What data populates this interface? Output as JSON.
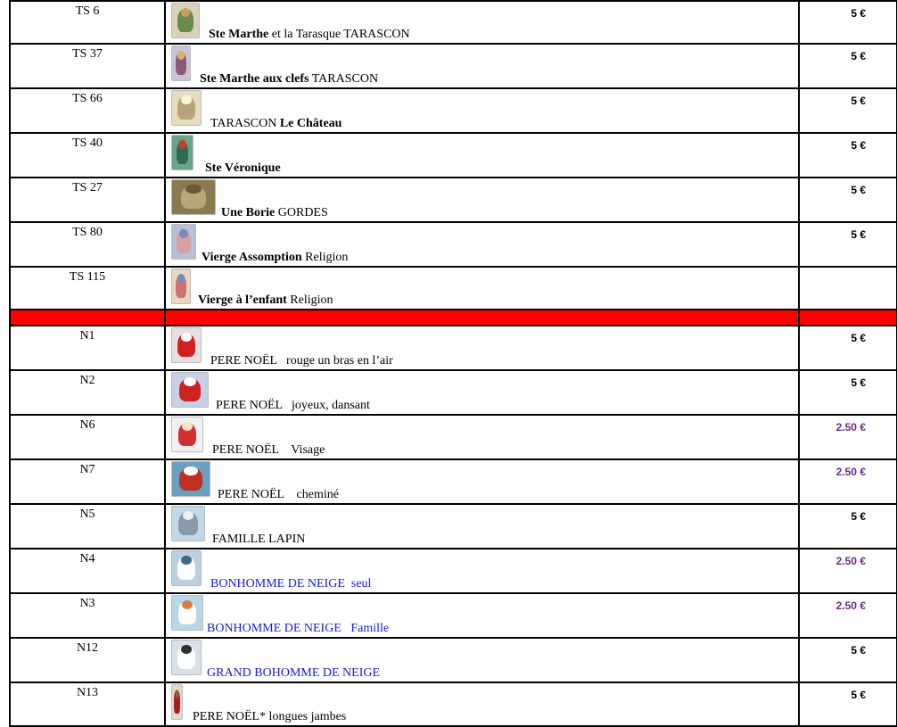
{
  "rows": [
    {
      "code": "TS 6",
      "icon": "saint-marthe-figure-icon",
      "parts": [
        {
          "t": "Ste Marthe",
          "b": true
        },
        {
          "t": " et la Tarasque TARASCON"
        }
      ],
      "price": "5 €"
    },
    {
      "code": "TS 37",
      "icon": "saint-marthe-keys-icon",
      "parts": [
        {
          "t": "Ste Marthe aux clefs",
          "b": true
        },
        {
          "t": " TARASCON"
        }
      ],
      "price": "5 €"
    },
    {
      "code": "TS 66",
      "icon": "castle-icon",
      "parts": [
        {
          "t": "TARASCON "
        },
        {
          "t": "Le Château",
          "b": true
        }
      ],
      "price": "5 €"
    },
    {
      "code": "TS 40",
      "icon": "saint-veronique-icon",
      "parts": [
        {
          "t": "Ste Véronique",
          "b": true
        }
      ],
      "price": "5 €"
    },
    {
      "code": "TS 27",
      "icon": "borie-hut-icon",
      "parts": [
        {
          "t": "Une Borie",
          "b": true
        },
        {
          "t": " GORDES"
        }
      ],
      "price": "5 €"
    },
    {
      "code": "TS 80",
      "icon": "virgin-assumption-icon",
      "parts": [
        {
          "t": "Vierge Assomption",
          "b": true
        },
        {
          "t": " Religion"
        }
      ],
      "price": "5 €"
    },
    {
      "code": "TS 115",
      "icon": "virgin-child-icon",
      "parts": [
        {
          "t": "Vierge à l’enfant",
          "b": true
        },
        {
          "t": " Religion"
        }
      ],
      "price": ""
    },
    {
      "sep": true
    },
    {
      "code": "N1",
      "icon": "santa-arm-up-icon",
      "parts": [
        {
          "t": "PERE NOËL   rouge un bras en l’air"
        }
      ],
      "price": "5 €"
    },
    {
      "code": "N2",
      "icon": "santa-dancing-icon",
      "parts": [
        {
          "t": "PERE NOËL   joyeux, dansant"
        }
      ],
      "price": "5 €"
    },
    {
      "code": "N6",
      "icon": "santa-face-icon",
      "parts": [
        {
          "t": "PERE NOËL    Visage"
        }
      ],
      "price": "2.50 €",
      "purple": true
    },
    {
      "code": "N7",
      "icon": "santa-chimney-icon",
      "parts": [
        {
          "t": "PERE NOËL    cheminé"
        }
      ],
      "price": "2.50 €",
      "purple": true
    },
    {
      "code": "N5",
      "icon": "rabbit-family-icon",
      "parts": [
        {
          "t": "FAMILLE LAPIN"
        }
      ],
      "price": "5 €"
    },
    {
      "code": "N4",
      "icon": "snowman-single-icon",
      "parts": [
        {
          "t": "BONHOMME DE NEIGE  seul"
        }
      ],
      "price": "2.50 €",
      "purple": true,
      "blue": true
    },
    {
      "code": "N3",
      "icon": "snowman-family-icon",
      "parts": [
        {
          "t": "BONHOMME DE NEIGE   Famille"
        }
      ],
      "price": "2.50 €",
      "purple": true,
      "blue": true
    },
    {
      "code": "N12",
      "icon": "big-snowman-icon",
      "parts": [
        {
          "t": "GRAND BOHOMME DE NEIGE"
        }
      ],
      "price": "5 €",
      "blue": true
    },
    {
      "code": "N13",
      "icon": "santa-long-legs-icon",
      "parts": [
        {
          "t": "PERE NOËL* longues jambes"
        }
      ],
      "price": "5 €"
    }
  ],
  "colors": {
    "separator": "#ff0000",
    "price_purple": "#6a2a8a",
    "text_blue": "#1a1ad6"
  }
}
